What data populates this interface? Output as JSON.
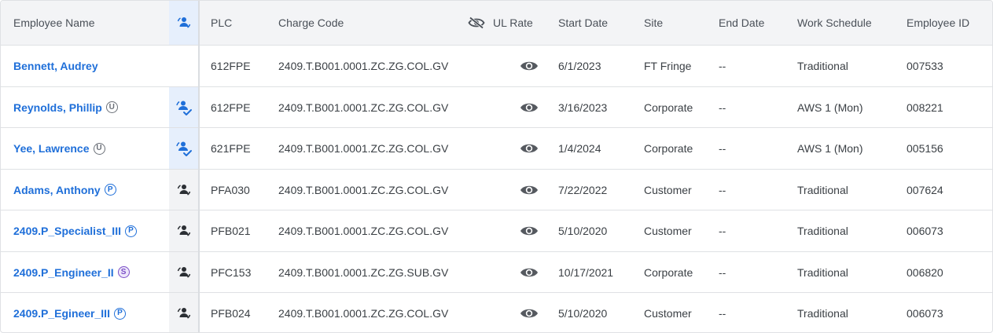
{
  "headers": {
    "name": "Employee Name",
    "plc": "PLC",
    "charge": "Charge Code",
    "ul": "UL Rate",
    "start": "Start Date",
    "site": "Site",
    "end": "End Date",
    "schedule": "Work Schedule",
    "empid": "Employee ID"
  },
  "rows": [
    {
      "name": "Bennett, Audrey",
      "badge": "",
      "icon": "none",
      "plc": "612FPE",
      "charge": "2409.T.B001.0001.ZC.ZG.COL.GV",
      "ul_icon": "eye-icon",
      "start": "6/1/2023",
      "site": "FT Fringe",
      "end": "--",
      "schedule": "Traditional",
      "empid": "007533"
    },
    {
      "name": "Reynolds, Phillip",
      "badge": "U",
      "icon": "assigned",
      "plc": "612FPE",
      "charge": "2409.T.B001.0001.ZC.ZG.COL.GV",
      "ul_icon": "eye-icon",
      "start": "3/16/2023",
      "site": "Corporate",
      "end": "--",
      "schedule": "AWS 1 (Mon)",
      "empid": "008221"
    },
    {
      "name": "Yee, Lawrence",
      "badge": "U",
      "icon": "assigned",
      "plc": "621FPE",
      "charge": "2409.T.B001.0001.ZC.ZG.COL.GV",
      "ul_icon": "eye-icon",
      "start": "1/4/2024",
      "site": "Corporate",
      "end": "--",
      "schedule": "AWS 1 (Mon)",
      "empid": "005156"
    },
    {
      "name": "Adams, Anthony",
      "badge": "P",
      "icon": "reassign",
      "plc": "PFA030",
      "charge": "2409.T.B001.0001.ZC.ZG.COL.GV",
      "ul_icon": "eye-icon",
      "start": "7/22/2022",
      "site": "Customer",
      "end": "--",
      "schedule": "Traditional",
      "empid": "007624"
    },
    {
      "name": "2409.P_Specialist_III",
      "badge": "P",
      "icon": "reassign",
      "plc": "PFB021",
      "charge": "2409.T.B001.0001.ZC.ZG.COL.GV",
      "ul_icon": "eye-icon",
      "start": "5/10/2020",
      "site": "Customer",
      "end": "--",
      "schedule": "Traditional",
      "empid": "006073"
    },
    {
      "name": "2409.P_Engineer_II",
      "badge": "S",
      "icon": "reassign",
      "plc": "PFC153",
      "charge": "2409.T.B001.0001.ZC.ZG.SUB.GV",
      "ul_icon": "eye-icon",
      "start": "10/17/2021",
      "site": "Corporate",
      "end": "--",
      "schedule": "Traditional",
      "empid": "006820"
    },
    {
      "name": "2409.P_Egineer_III",
      "badge": "P",
      "icon": "reassign",
      "plc": "PFB024",
      "charge": "2409.T.B001.0001.ZC.ZG.COL.GV",
      "ul_icon": "eye-icon",
      "start": "5/10/2020",
      "site": "Customer",
      "end": "--",
      "schedule": "Traditional",
      "empid": "006073"
    }
  ],
  "colors": {
    "link": "#1f6fd9",
    "accent": "#1f6fd9",
    "purple": "#7b4fc7"
  }
}
